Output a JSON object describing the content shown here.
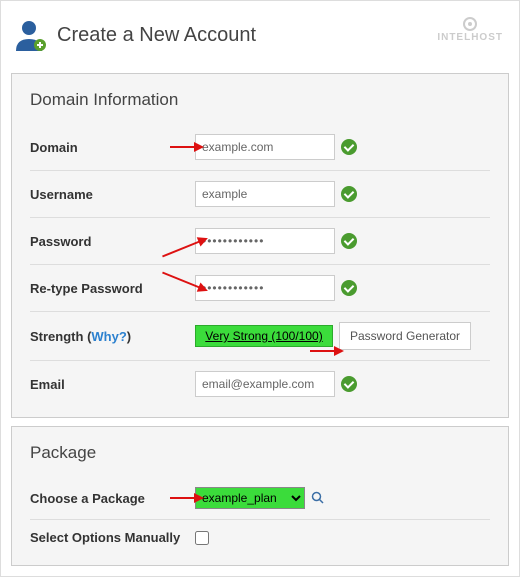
{
  "header": {
    "title": "Create a New Account",
    "brand": "INTELHOST"
  },
  "domain_info": {
    "title": "Domain Information",
    "domain_label": "Domain",
    "domain_value": "example.com",
    "username_label": "Username",
    "username_value": "example",
    "password_label": "Password",
    "password_value": "••••••••••••",
    "retype_label": "Re-type Password",
    "retype_value": "••••••••••••",
    "strength_label": "Strength",
    "why_label": "Why?",
    "strength_value": "Very Strong (100/100)",
    "generator_btn": "Password Generator",
    "email_label": "Email",
    "email_value": "email@example.com"
  },
  "package": {
    "title": "Package",
    "choose_label": "Choose a Package",
    "choose_value": "example_plan",
    "manual_label": "Select Options Manually"
  }
}
